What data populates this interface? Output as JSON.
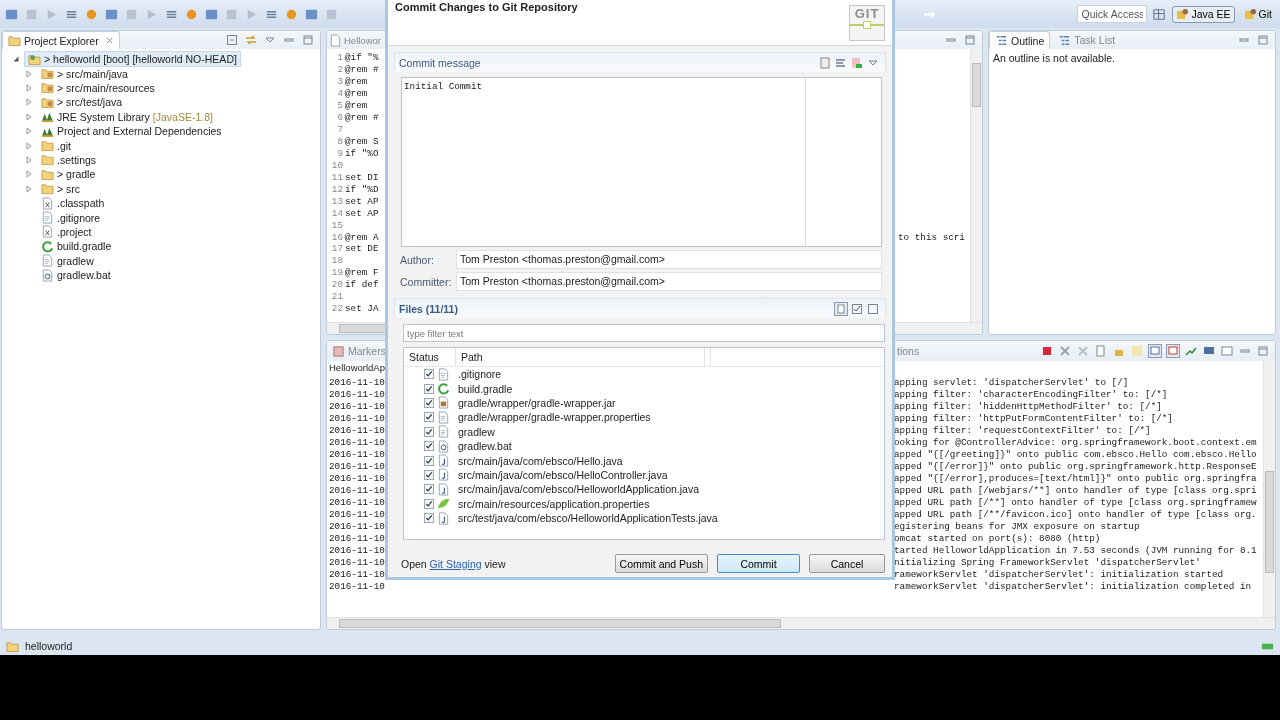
{
  "toolbar": {
    "quick_access": {
      "placeholder": "Quick Access"
    },
    "perspectives": [
      {
        "label": "Java EE",
        "selected": true
      },
      {
        "label": "Git",
        "selected": false
      }
    ]
  },
  "project_explorer": {
    "tab": {
      "label": "Project Explorer",
      "selected": true
    },
    "tree": [
      {
        "label": "> helloworld [boot]  [helloworld NO-HEAD]",
        "kind": "project",
        "expanded": true,
        "selected": true,
        "children": [
          {
            "label": "> src/main/java",
            "kind": "source-folder",
            "expanded": false,
            "selected": false
          },
          {
            "label": "> src/main/resources",
            "kind": "source-folder",
            "expanded": false,
            "selected": false
          },
          {
            "label": "> src/test/java",
            "kind": "source-folder",
            "expanded": false,
            "selected": false
          },
          {
            "label": "JRE System Library",
            "decoration": "[JavaSE-1.8]",
            "kind": "library",
            "expanded": false,
            "selected": false
          },
          {
            "label": "Project and External Dependencies",
            "kind": "library",
            "expanded": false,
            "selected": false
          },
          {
            "label": ".git",
            "kind": "folder",
            "expanded": false,
            "selected": false
          },
          {
            "label": ".settings",
            "kind": "folder",
            "expanded": false,
            "selected": false
          },
          {
            "label": "> gradle",
            "kind": "folder",
            "expanded": false,
            "selected": false
          },
          {
            "label": "> src",
            "kind": "folder",
            "expanded": false,
            "selected": false
          },
          {
            "label": ".classpath",
            "kind": "xml",
            "selected": false
          },
          {
            "label": ".gitignore",
            "kind": "text",
            "selected": false
          },
          {
            "label": ".project",
            "kind": "xml",
            "selected": false
          },
          {
            "label": "build.gradle",
            "kind": "gradle",
            "selected": false
          },
          {
            "label": "gradlew",
            "kind": "text",
            "selected": false
          },
          {
            "label": "gradlew.bat",
            "kind": "bat",
            "selected": false
          }
        ]
      }
    ]
  },
  "editor": {
    "tab": {
      "label": "Hellowor",
      "selected": false
    },
    "lines": [
      {
        "number": "1",
        "text": "@if \"%"
      },
      {
        "number": "2",
        "text": "@rem #"
      },
      {
        "number": "3",
        "text": "@rem"
      },
      {
        "number": "4",
        "text": "@rem"
      },
      {
        "number": "5",
        "text": "@rem"
      },
      {
        "number": "6",
        "text": "@rem #"
      },
      {
        "number": "7"
      },
      {
        "number": "8",
        "text": "@rem S"
      },
      {
        "number": "9",
        "text": "if \"%O"
      },
      {
        "number": "10"
      },
      {
        "number": "11",
        "text": "set DI"
      },
      {
        "number": "12",
        "text": "if \"%D"
      },
      {
        "number": "13",
        "text": "set AP"
      },
      {
        "number": "14",
        "text": "set AP"
      },
      {
        "number": "15"
      },
      {
        "number": "16",
        "text": "@rem A",
        "tail": "to this scri"
      },
      {
        "number": "17",
        "text": "set DE"
      },
      {
        "number": "18"
      },
      {
        "number": "19",
        "text": "@rem F"
      },
      {
        "number": "20",
        "text": "if def"
      },
      {
        "number": "21"
      },
      {
        "number": "22",
        "text": "set JA"
      }
    ]
  },
  "outline": {
    "tabs": [
      {
        "label": "Outline",
        "selected": true
      },
      {
        "label": "Task List",
        "selected": false
      }
    ],
    "message": "An outline is not available."
  },
  "console": {
    "tabs": [
      {
        "label": "Markers",
        "selected": false
      },
      {
        "label": "tions",
        "selected": false
      }
    ],
    "header": "HelloworldAp",
    "rows": [
      {
        "date": "2016-11-10",
        "message": "apping servlet: 'dispatcherServlet' to [/]"
      },
      {
        "date": "2016-11-10",
        "message": "apping filter: 'characterEncodingFilter' to: [/*]"
      },
      {
        "date": "2016-11-10",
        "message": "apping filter: 'hiddenHttpMethodFilter' to: [/*]"
      },
      {
        "date": "2016-11-10",
        "message": "apping filter: 'httpPutFormContentFilter' to: [/*]"
      },
      {
        "date": "2016-11-10",
        "message": "apping filter: 'requestContextFilter' to: [/*]"
      },
      {
        "date": "2016-11-10",
        "message": "ooking for @ControllerAdvice: org.springframework.boot.context.em"
      },
      {
        "date": "2016-11-10",
        "message": "apped \"{[/greeting]}\" onto public com.ebsco.Hello com.ebsco.Hello"
      },
      {
        "date": "2016-11-10",
        "message": "apped \"{[/error]}\" onto public org.springframework.http.ResponseE"
      },
      {
        "date": "2016-11-10",
        "message": "apped \"{[/error],produces=[text/html]}\" onto public org.springfra"
      },
      {
        "date": "2016-11-10",
        "message": "apped URL path [/webjars/**] onto handler of type [class org.spri"
      },
      {
        "date": "2016-11-10",
        "message": "apped URL path [/**] onto handler of type [class org.springframew"
      },
      {
        "date": "2016-11-10",
        "message": "apped URL path [/**/favicon.ico] onto handler of type [class org."
      },
      {
        "date": "2016-11-10",
        "message": "egistering beans for JMX exposure on startup"
      },
      {
        "date": "2016-11-10",
        "message": "omcat started on port(s): 8080 (http)"
      },
      {
        "date": "2016-11-10",
        "message": "tarted HelloworldApplication in 7.53 seconds (JVM running for 8.1"
      },
      {
        "date": "2016-11-10",
        "message": "nitializing Spring FrameworkServlet 'dispatcherServlet'"
      },
      {
        "date": "2016-11-10",
        "message": "rameworkServlet 'dispatcherServlet': initialization started"
      },
      {
        "date": "2016-11-10",
        "message": "rameworkServlet 'dispatcherServlet': initialization completed in"
      }
    ]
  },
  "dialog": {
    "title": "Commit Changes to Git Repository",
    "logo_text": "GIT",
    "commit_message": {
      "heading": "Commit message",
      "value": "Initial Commit"
    },
    "author": {
      "label": "Author:",
      "value": "Tom Preston <thomas.preston@gmail.com>"
    },
    "committer": {
      "label": "Committer:",
      "value": "Tom Preston <thomas.preston@gmail.com>"
    },
    "files": {
      "heading": "Files (11/11)",
      "filter": {
        "placeholder": "type filter text"
      },
      "columns": [
        "Status",
        "Path"
      ],
      "rows": [
        {
          "checked": true,
          "kind": "text",
          "path": ".gitignore"
        },
        {
          "checked": true,
          "kind": "gradle",
          "path": "build.gradle"
        },
        {
          "checked": true,
          "kind": "jar",
          "path": "gradle/wrapper/gradle-wrapper.jar"
        },
        {
          "checked": true,
          "kind": "text",
          "path": "gradle/wrapper/gradle-wrapper.properties"
        },
        {
          "checked": true,
          "kind": "text",
          "path": "gradlew"
        },
        {
          "checked": true,
          "kind": "bat",
          "path": "gradlew.bat"
        },
        {
          "checked": true,
          "kind": "java",
          "path": "src/main/java/com/ebsco/Hello.java"
        },
        {
          "checked": true,
          "kind": "java",
          "path": "src/main/java/com/ebsco/HelloController.java"
        },
        {
          "checked": true,
          "kind": "java",
          "path": "src/main/java/com/ebsco/HelloworldApplication.java"
        },
        {
          "checked": true,
          "kind": "properties",
          "path": "src/main/resources/application.properties"
        },
        {
          "checked": true,
          "kind": "java",
          "path": "src/test/java/com/ebsco/HelloworldApplicationTests.java"
        }
      ]
    },
    "hint": {
      "before": "Open",
      "link": "Git Staging",
      "after": "view"
    },
    "buttons": [
      {
        "label": "Commit and Push",
        "default": false
      },
      {
        "label": "Commit",
        "default": true
      },
      {
        "label": "Cancel",
        "default": false
      }
    ]
  },
  "status_bar": {
    "text": "helloworld"
  }
}
